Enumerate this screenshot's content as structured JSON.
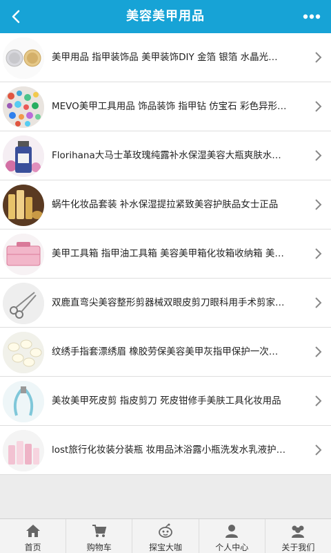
{
  "header": {
    "title": "美容美甲用品",
    "back_icon": "chevron-left-icon",
    "more_icon": "more-dots-icon"
  },
  "colors": {
    "accent": "#17a3d6",
    "background": "#ececec"
  },
  "items": [
    {
      "title": "美甲用品 指甲装饰品 美甲装饰DIY 金箔 银箔 水晶光…",
      "image": "nail-decoration-jars"
    },
    {
      "title": "MEVO美甲工具用品 饰品装饰 指甲钻 仿宝石 彩色异形…",
      "image": "colorful-gems"
    },
    {
      "title": "Florihana大马士革玫瑰纯露补水保湿美容大瓶爽肤水…",
      "image": "rose-toner-bottle"
    },
    {
      "title": "蜗牛化妆品套装 补水保湿提拉紧致美容护肤品女士正品",
      "image": "gold-cosmetics-set"
    },
    {
      "title": "美甲工具箱 指甲油工具箱 美容美甲箱化妆箱收纳箱 美…",
      "image": "pink-toolbox"
    },
    {
      "title": "双鹿直弯尖美容整形剪器械双眼皮剪刀眼科用手术剪家…",
      "image": "surgical-scissors"
    },
    {
      "title": "纹绣手指套漂绣眉 橡胶劳保美容美甲灰指甲保护一次…",
      "image": "finger-cots"
    },
    {
      "title": "美妆美甲死皮剪 指皮剪刀 死皮钳修手美肤工具化妆用品",
      "image": "cuticle-nipper"
    },
    {
      "title": "lost旅行化妆装分装瓶 妆用品沐浴露小瓶洗发水乳液护…",
      "image": "travel-bottles"
    }
  ],
  "tabbar": [
    {
      "label": "首页",
      "icon": "home-icon"
    },
    {
      "label": "购物车",
      "icon": "cart-icon"
    },
    {
      "label": "探宝大咖",
      "icon": "mascot-icon"
    },
    {
      "label": "个人中心",
      "icon": "user-icon"
    },
    {
      "label": "关于我们",
      "icon": "group-icon"
    }
  ]
}
